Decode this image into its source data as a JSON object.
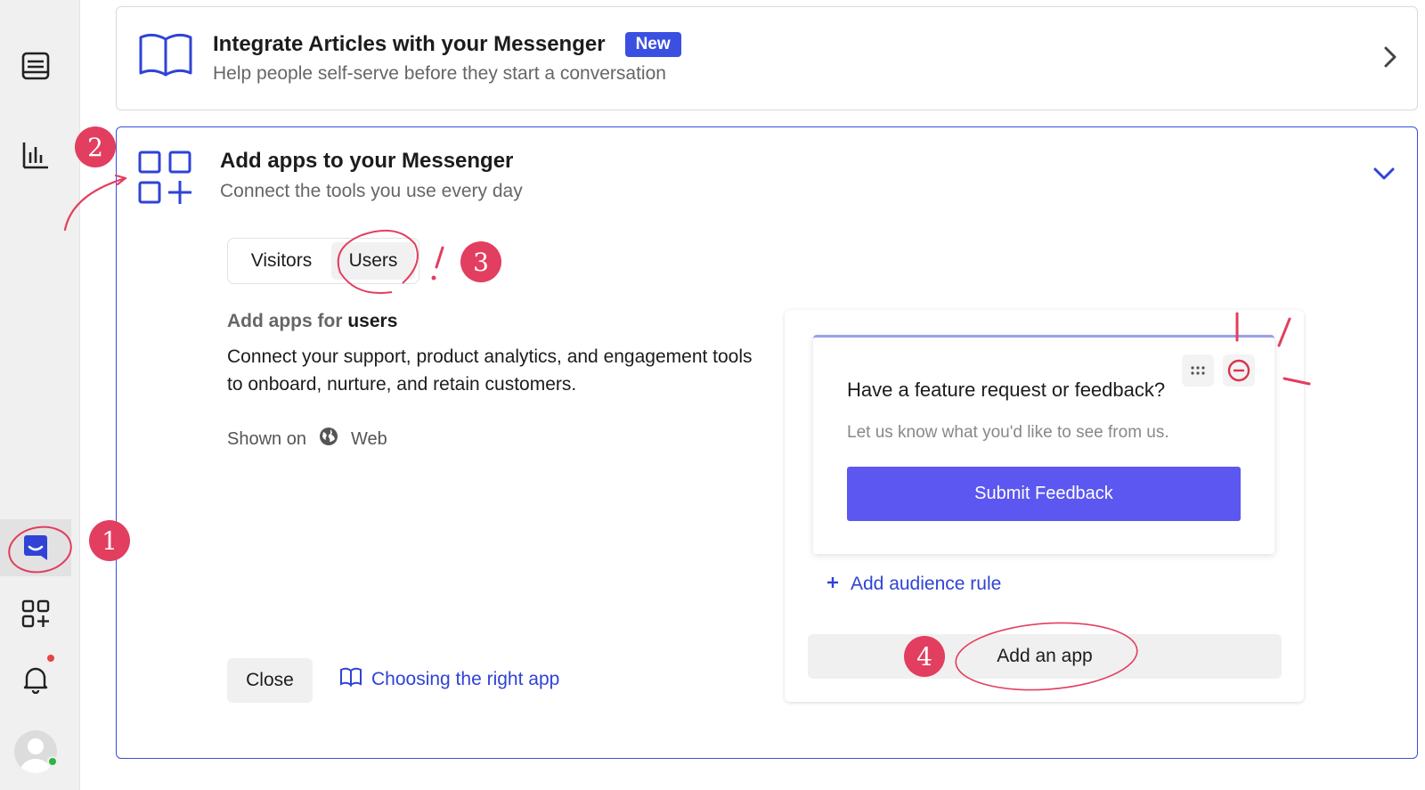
{
  "sidebar": {
    "items": [
      {
        "icon": "inbox-icon"
      },
      {
        "icon": "reports-bar-chart-icon"
      },
      {
        "icon": "messenger-icon",
        "active": true
      },
      {
        "icon": "apps-grid-plus-icon"
      },
      {
        "icon": "bell-icon",
        "notification": true
      },
      {
        "icon": "user-avatar-icon",
        "status": "online"
      }
    ]
  },
  "articles_card": {
    "title": "Integrate Articles with your Messenger",
    "badge": "New",
    "subtitle": "Help people self-serve before they start a conversation"
  },
  "apps_card": {
    "title": "Add apps to your Messenger",
    "subtitle": "Connect the tools you use every day",
    "tabs": [
      {
        "label": "Visitors",
        "selected": false
      },
      {
        "label": "Users",
        "selected": true
      }
    ],
    "section_prefix": "Add apps for",
    "section_audience": "users",
    "description": "Connect your support, product analytics, and engagement tools to onboard, nurture, and retain customers.",
    "shown_on_label": "Shown on",
    "shown_on_value": "Web",
    "close_label": "Close",
    "help_link": "Choosing the right app"
  },
  "preview": {
    "widget_title": "Have a feature request or feedback?",
    "widget_subtitle": "Let us know what you'd like to see from us.",
    "submit_label": "Submit Feedback",
    "add_audience_rule": "Add audience rule",
    "add_app": "Add an app"
  },
  "annotations": [
    "1",
    "2",
    "3",
    "4"
  ],
  "colors": {
    "accent": "#3b4fe0",
    "link": "#2f43d6",
    "annotation": "#e23e5f",
    "submit": "#5b57f0"
  }
}
